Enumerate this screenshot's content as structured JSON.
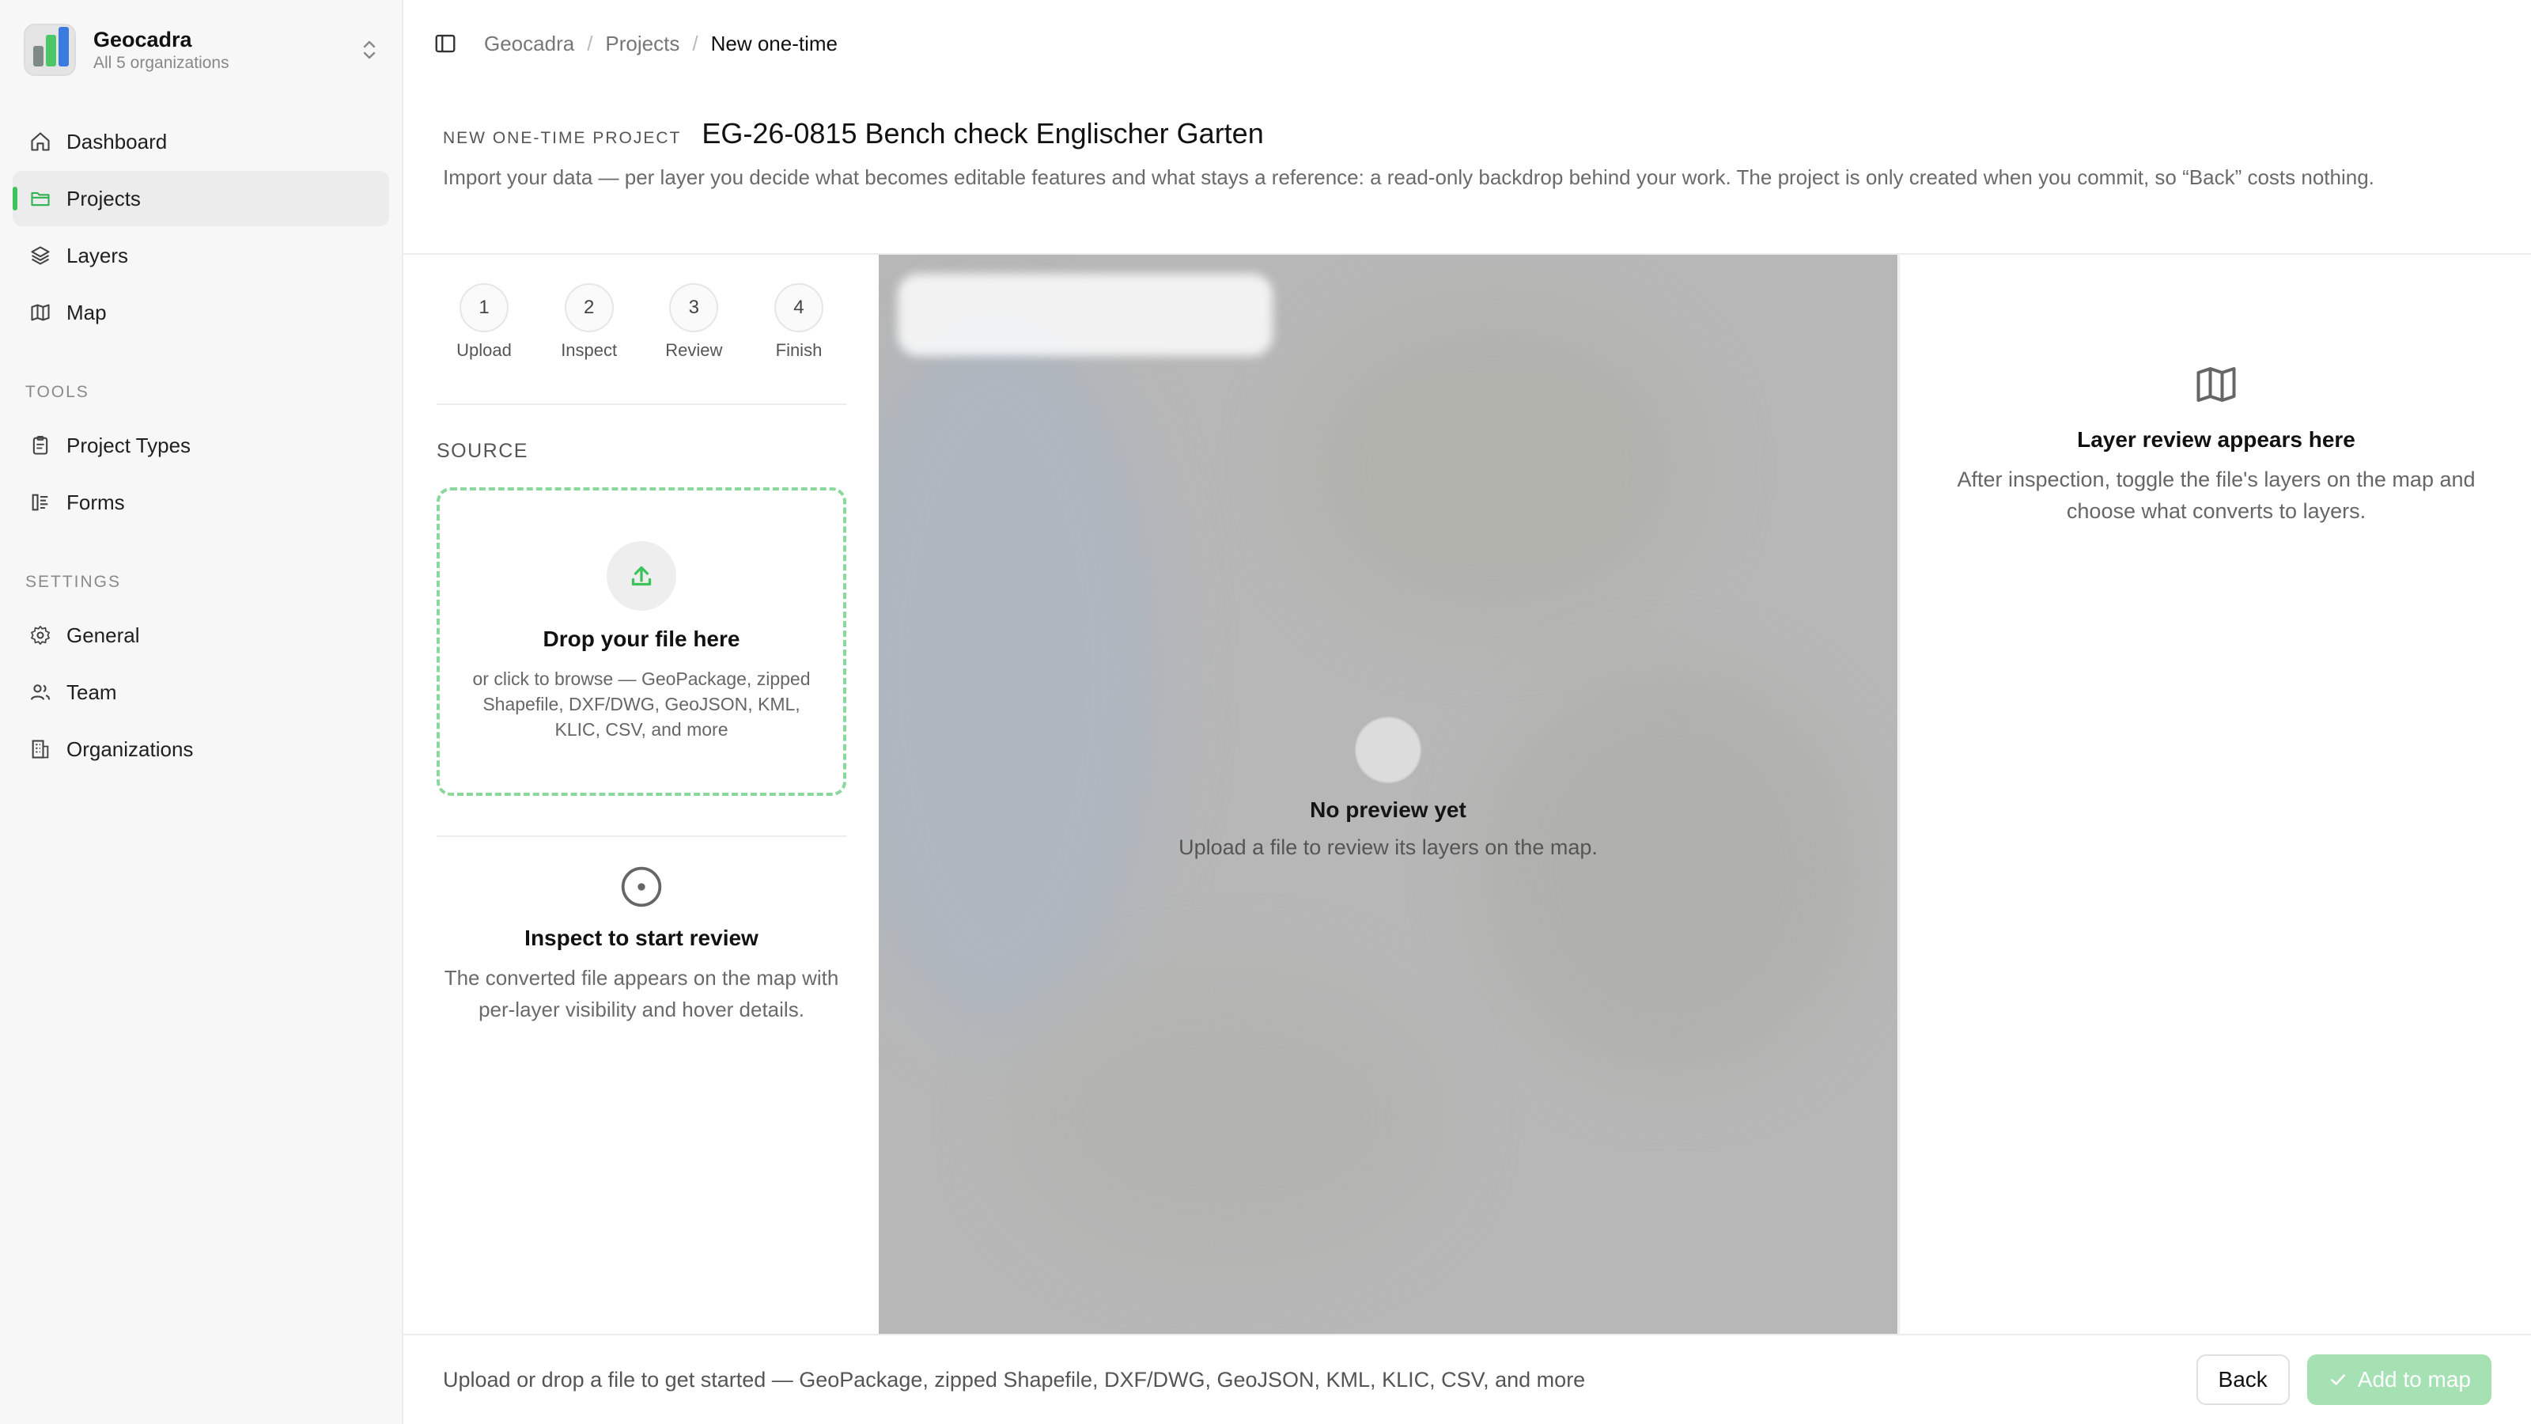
{
  "org": {
    "name": "Geocadra",
    "subtitle": "All 5 organizations"
  },
  "sidebar": {
    "main_items": [
      {
        "label": "Dashboard",
        "icon": "home-icon"
      },
      {
        "label": "Projects",
        "icon": "folder-icon",
        "active": true
      },
      {
        "label": "Layers",
        "icon": "layers-icon"
      },
      {
        "label": "Map",
        "icon": "map-icon"
      }
    ],
    "tools_heading": "TOOLS",
    "tools_items": [
      {
        "label": "Project Types",
        "icon": "clipboard-icon"
      },
      {
        "label": "Forms",
        "icon": "form-icon"
      }
    ],
    "settings_heading": "SETTINGS",
    "settings_items": [
      {
        "label": "General",
        "icon": "gear-icon"
      },
      {
        "label": "Team",
        "icon": "users-icon"
      },
      {
        "label": "Organizations",
        "icon": "building-icon"
      }
    ]
  },
  "breadcrumb": [
    "Geocadra",
    "Projects",
    "New one-time"
  ],
  "header": {
    "kicker": "NEW ONE-TIME PROJECT",
    "title": "EG-26-0815 Bench check Englischer Garten",
    "description": "Import your data — per layer you decide what becomes editable features and what stays a reference: a read-only backdrop behind your work. The project is only created when you commit, so “Back” costs nothing."
  },
  "steps": [
    {
      "number": "1",
      "label": "Upload"
    },
    {
      "number": "2",
      "label": "Inspect"
    },
    {
      "number": "3",
      "label": "Review"
    },
    {
      "number": "4",
      "label": "Finish"
    }
  ],
  "source": {
    "label": "SOURCE",
    "drop_title": "Drop your file here",
    "drop_sub": "or click to browse — GeoPackage, zipped Shapefile, DXF/DWG, GeoJSON, KML, KLIC, CSV, and more"
  },
  "inspect": {
    "title": "Inspect to start review",
    "sub": "The converted file appears on the map with per-layer visibility and hover details."
  },
  "map": {
    "empty_title": "No preview yet",
    "empty_sub": "Upload a file to review its layers on the map."
  },
  "review": {
    "title": "Layer review appears here",
    "sub": "After inspection, toggle the file's layers on the map and choose what converts to layers."
  },
  "footer": {
    "hint": "Upload or drop a file to get started — GeoPackage, zipped Shapefile, DXF/DWG, GeoJSON, KML, KLIC, CSV, and more",
    "back_label": "Back",
    "primary_label": "Add to map"
  },
  "colors": {
    "accent": "#3ec35c",
    "dropzone_border": "#8bd89c",
    "primary_disabled": "#a5e1b3"
  }
}
